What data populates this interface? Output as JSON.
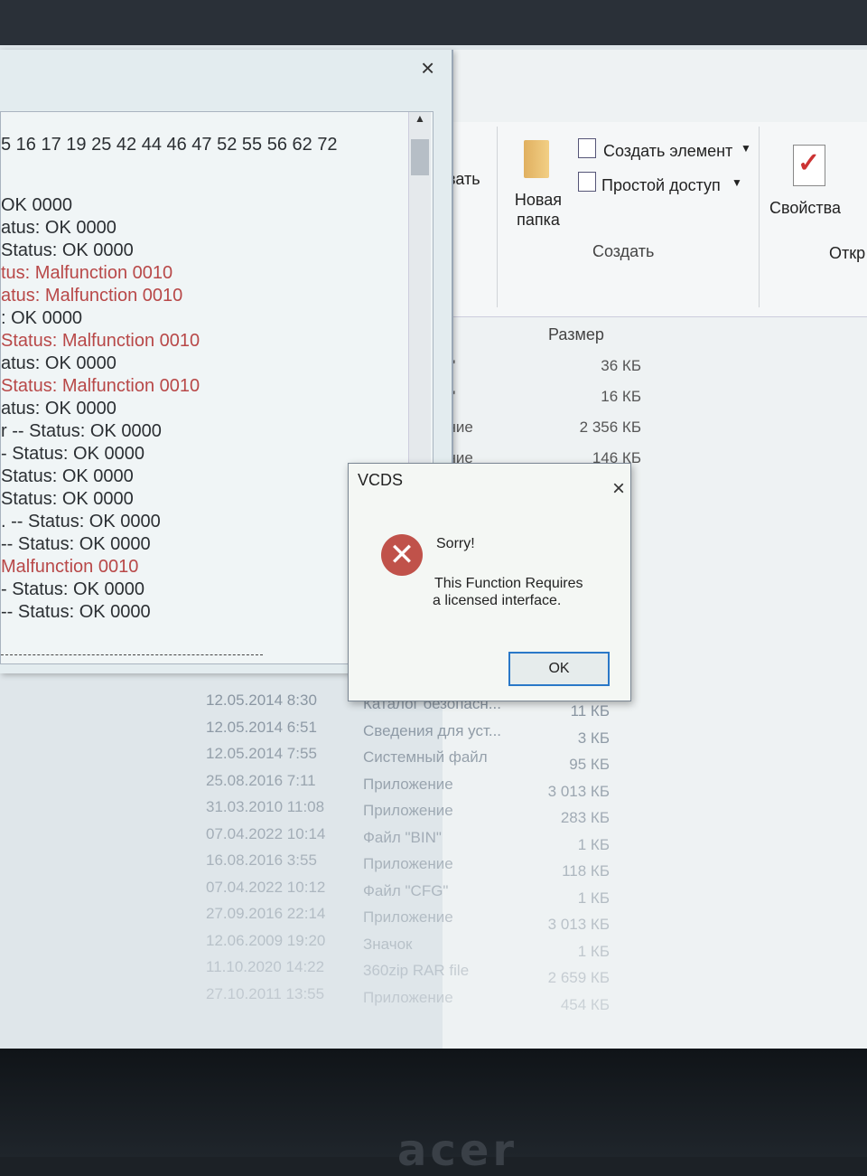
{
  "explorer": {
    "ribbon": {
      "partial_label": "вать",
      "new_folder": "Новая папка",
      "create_item": "Создать элемент",
      "easy_access": "Простой доступ",
      "group_create": "Создать",
      "properties": "Свойства",
      "open_partial": "Откр"
    },
    "column_size": "Размер",
    "top_rows": [
      {
        "type": "N\"",
        "size": "36 КБ"
      },
      {
        "type": "N\"",
        "size": "16 КБ"
      },
      {
        "type": "ение",
        "size": "2 356 КБ"
      },
      {
        "type": "ение",
        "size": "146 КБ"
      }
    ],
    "rows": [
      {
        "date": "12.05.2014 8:30",
        "type": "Каталог безопасн...",
        "size": "11 КБ"
      },
      {
        "date": "12.05.2014 6:51",
        "type": "Сведения для уст...",
        "size": "3 КБ"
      },
      {
        "date": "12.05.2014 7:55",
        "type": "Системный файл",
        "size": "95 КБ"
      },
      {
        "date": "25.08.2016 7:11",
        "type": "Приложение",
        "size": "3 013 КБ"
      },
      {
        "date": "31.03.2010 11:08",
        "type": "Приложение",
        "size": "283 КБ"
      },
      {
        "date": "07.04.2022 10:14",
        "type": "Файл \"BIN\"",
        "size": "1 КБ"
      },
      {
        "date": "16.08.2016 3:55",
        "type": "Приложение",
        "size": "118 КБ"
      },
      {
        "date": "07.04.2022 10:12",
        "type": "Файл \"CFG\"",
        "size": "1 КБ"
      },
      {
        "date": "27.09.2016 22:14",
        "type": "Приложение",
        "size": "3 013 КБ"
      },
      {
        "date": "12.06.2009 19:20",
        "type": "Значок",
        "size": "1 КБ"
      },
      {
        "date": "11.10.2020 14:22",
        "type": "360zip RAR file",
        "size": "2 659 КБ"
      },
      {
        "date": "27.10.2011 13:55",
        "type": "Приложение",
        "size": "454 КБ"
      }
    ]
  },
  "vcds_window": {
    "close_icon": "×",
    "address_line": "5 16 17 19 25 42 44 46 47 52 55 56 62 72",
    "lines": [
      {
        "text": "OK 0000",
        "status": "ok"
      },
      {
        "text": "atus: OK 0000",
        "status": "ok"
      },
      {
        "text": "Status: OK 0000",
        "status": "ok"
      },
      {
        "text": "tus: Malfunction 0010",
        "status": "malfunction"
      },
      {
        "text": "atus: Malfunction 0010",
        "status": "malfunction"
      },
      {
        "text": ": OK 0000",
        "status": "ok"
      },
      {
        "text": " Status: Malfunction 0010",
        "status": "malfunction"
      },
      {
        "text": "atus: OK 0000",
        "status": "ok"
      },
      {
        "text": "Status: Malfunction 0010",
        "status": "malfunction"
      },
      {
        "text": "atus: OK 0000",
        "status": "ok"
      },
      {
        "text": "r -- Status: OK 0000",
        "status": "ok"
      },
      {
        "text": "- Status: OK 0000",
        "status": "ok"
      },
      {
        "text": "Status: OK 0000",
        "status": "ok"
      },
      {
        "text": " Status: OK 0000",
        "status": "ok"
      },
      {
        "text": ". -- Status: OK 0000",
        "status": "ok"
      },
      {
        "text": " -- Status: OK 0000",
        "status": "ok"
      },
      {
        "text": "Malfunction 0010",
        "status": "malfunction"
      },
      {
        "text": "- Status: OK 0000",
        "status": "ok"
      },
      {
        "text": " -- Status: OK 0000",
        "status": "ok"
      }
    ]
  },
  "dialog": {
    "title": "VCDS",
    "close_icon": "×",
    "icon": "error-icon",
    "heading": "Sorry!",
    "message_line1": "This Function Requires",
    "message_line2": "a licensed interface.",
    "ok_label": "OK"
  },
  "colors": {
    "ok_text": "#2b2f33",
    "malfunction_text": "#b84848",
    "error_icon": "#c0524a",
    "ok_button_border": "#2a78c8"
  },
  "bezel_logo": "acer"
}
